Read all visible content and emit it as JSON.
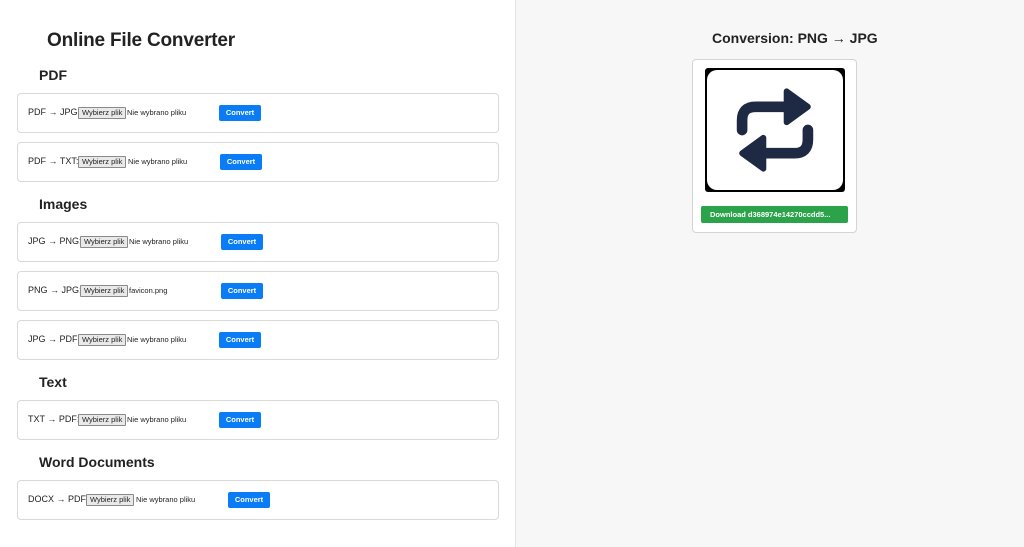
{
  "app": {
    "title": "Online File Converter"
  },
  "sections": {
    "pdf": "PDF",
    "images": "Images",
    "text": "Text",
    "word": "Word Documents"
  },
  "converters": [
    {
      "label": "PDF → JPG:",
      "file_button": "Wybierz plik",
      "file_status": "Nie wybrano pliku",
      "convert": "Convert"
    },
    {
      "label": "PDF → TXT:",
      "file_button": "Wybierz plik",
      "file_status": "Nie wybrano pliku",
      "convert": "Convert"
    },
    {
      "label": "JPG → PNG:",
      "file_button": "Wybierz plik",
      "file_status": "Nie wybrano pliku",
      "convert": "Convert"
    },
    {
      "label": "PNG → JPG:",
      "file_button": "Wybierz plik",
      "file_status": "favicon.png",
      "convert": "Convert"
    },
    {
      "label": "JPG → PDF:",
      "file_button": "Wybierz plik",
      "file_status": "Nie wybrano pliku",
      "convert": "Convert"
    },
    {
      "label": "TXT → PDF:",
      "file_button": "Wybierz plik",
      "file_status": "Nie wybrano pliku",
      "convert": "Convert"
    },
    {
      "label": "DOCX → PDF:",
      "file_button": "Wybierz plik",
      "file_status": "Nie wybrano pliku",
      "convert": "Convert"
    }
  ],
  "result": {
    "title": "Conversion: PNG → JPG",
    "preview_icon": "convert-arrows-icon",
    "download_label": "Download d368974e14270ccdd5..."
  },
  "colors": {
    "convert_button": "#0a7cf5",
    "download_button": "#2aa34a",
    "icon": "#1e2a44"
  }
}
